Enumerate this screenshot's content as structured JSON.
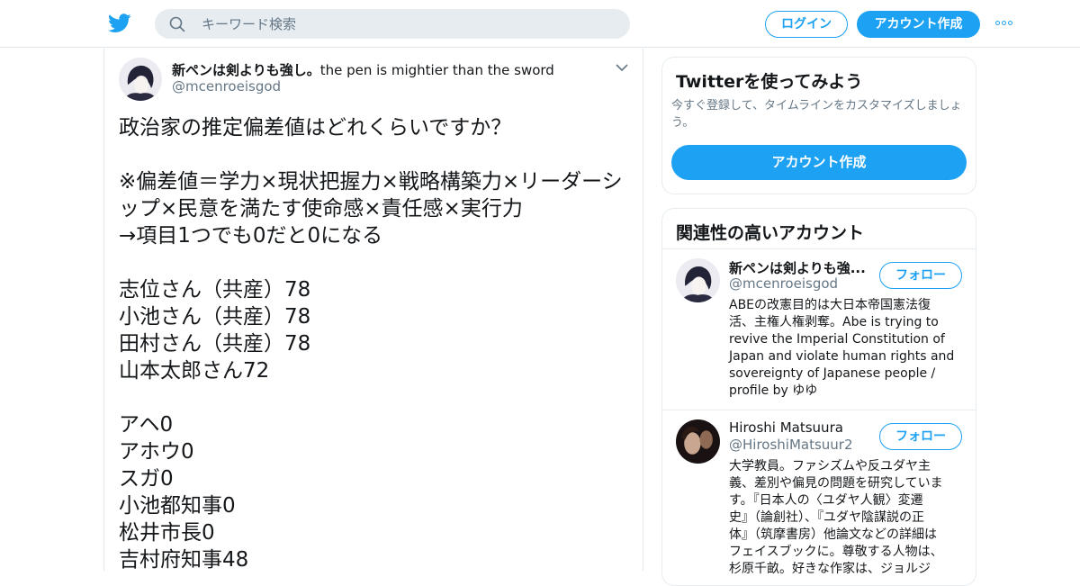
{
  "header": {
    "search_placeholder": "キーワード検索",
    "login_label": "ログイン",
    "signup_label": "アカウント作成"
  },
  "tweet": {
    "author_name": "新ペンは剣よりも強し。",
    "author_name_latin": "the pen is mightier than the sword",
    "author_handle": "@mcenroeisgod",
    "lines": [
      "政治家の推定偏差値はどれくらいですか？",
      "",
      "※偏差値＝学力×現状把握力×戦略構築力×リーダーシ",
      "ップ×民意を満たす使命感×責任感×実行力",
      "→項目1つでも0だと0になる",
      "",
      "志位さん（共産）78",
      "小池さん（共産）78",
      "田村さん（共産）78",
      "山本太郎さん72",
      "",
      "アヘ0",
      "アホウ0",
      "スガ0",
      "小池都知事0",
      "松井市長0",
      "吉村府知事48"
    ]
  },
  "sidebar": {
    "signup_card": {
      "title": "Twitterを使ってみよう",
      "description": "今すぐ登録して、タイムラインをカスタマイズしましょう。",
      "button_label": "アカウント作成"
    },
    "related": {
      "title": "関連性の高いアカウント",
      "follow_label": "フォロー",
      "accounts": [
        {
          "name": "新ペンは剣よりも強...",
          "handle": "@mcenroeisgod",
          "bio_lines": [
            "ABEの改憲目的は大日本帝国憲法復",
            "活、主権人権剥奪。Abe is trying to",
            "revive the Imperial Constitution of",
            "Japan and violate human rights and",
            "sovereignty of Japanese people /",
            "profile by ゆゆ"
          ]
        },
        {
          "name": "Hiroshi Matsuura",
          "handle": "@HiroshiMatsuur2",
          "bio_lines": [
            "大学教員。ファシズムや反ユダヤ主",
            "義、差別や偏見の問題を研究していま",
            "す。『日本人の〈ユダヤ人観〉変遷",
            "史』（論創社）、『ユダヤ陰謀説の正",
            "体』（筑摩書房）他論文などの詳細は",
            "フェイスブックに。尊敬する人物は、",
            "杉原千畝。好きな作家は、ジョルジ"
          ]
        }
      ]
    }
  },
  "colors": {
    "brand_blue": "#1da1f2",
    "secondary_text": "#657786",
    "border": "#e6ecf0"
  }
}
